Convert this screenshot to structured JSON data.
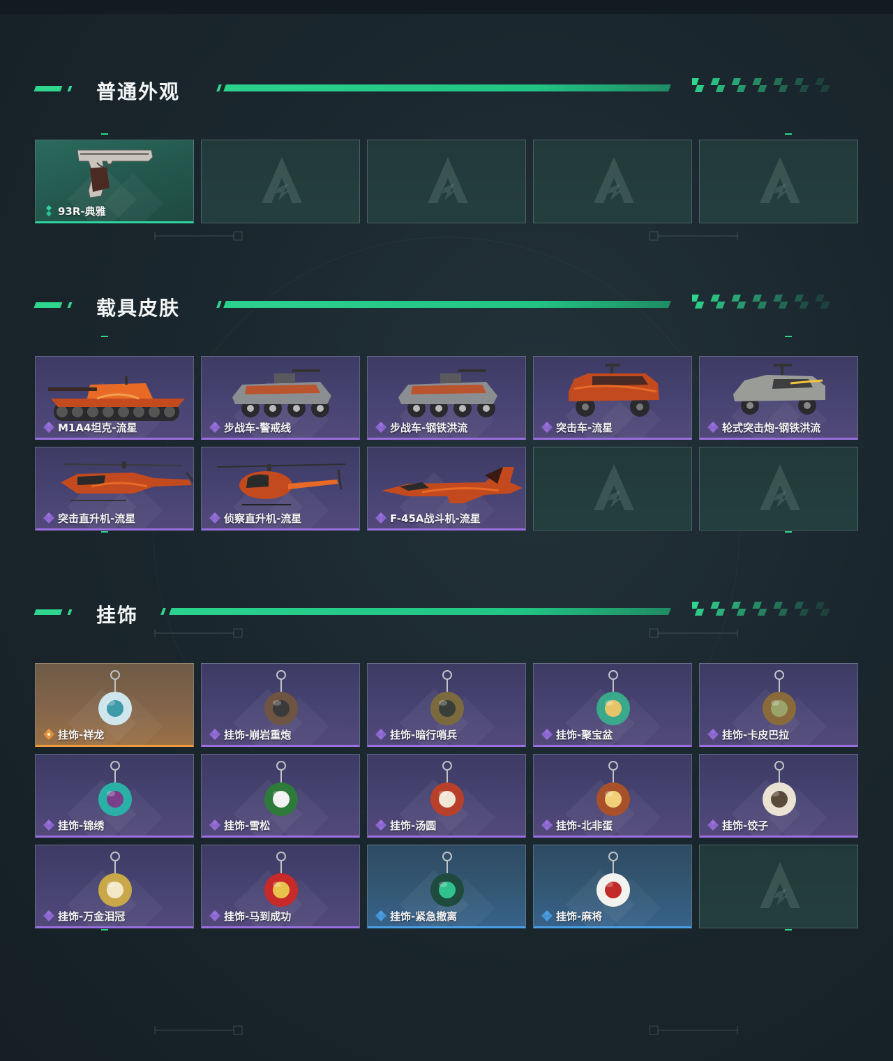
{
  "sections": {
    "appearance": {
      "title": "普通外观",
      "items": [
        {
          "label": "93R-典雅",
          "rarity": "green",
          "icon": "pistol-icon"
        }
      ]
    },
    "vehicle": {
      "title": "载具皮肤",
      "items": [
        {
          "label": "M1A4坦克-流星",
          "rarity": "purple",
          "icon": "tank-icon"
        },
        {
          "label": "步战车-警戒线",
          "rarity": "purple",
          "icon": "ifv-icon"
        },
        {
          "label": "步战车-钢铁洪流",
          "rarity": "purple",
          "icon": "ifv-icon"
        },
        {
          "label": "突击车-流星",
          "rarity": "purple",
          "icon": "assault-vehicle-icon"
        },
        {
          "label": "轮式突击炮-钢铁洪流",
          "rarity": "purple",
          "icon": "wheeled-assault-gun-icon"
        },
        {
          "label": "突击直升机-流星",
          "rarity": "purple",
          "icon": "attack-helicopter-icon"
        },
        {
          "label": "侦察直升机-流星",
          "rarity": "purple",
          "icon": "scout-helicopter-icon"
        },
        {
          "label": "F-45A战斗机-流星",
          "rarity": "purple",
          "icon": "fighter-jet-icon"
        }
      ]
    },
    "charm": {
      "title": "挂饰",
      "items": [
        {
          "label": "挂饰-祥龙",
          "rarity": "gold",
          "icon": "dragon-charm-icon"
        },
        {
          "label": "挂饰-崩岩重炮",
          "rarity": "purple",
          "icon": "soldier-charm-icon"
        },
        {
          "label": "挂饰-暗行哨兵",
          "rarity": "purple",
          "icon": "sentinel-charm-icon"
        },
        {
          "label": "挂饰-聚宝盆",
          "rarity": "purple",
          "icon": "treasure-bowl-charm-icon"
        },
        {
          "label": "挂饰-卡皮巴拉",
          "rarity": "purple",
          "icon": "capybara-charm-icon"
        },
        {
          "label": "挂饰-锦绣",
          "rarity": "purple",
          "icon": "butterfly-charm-icon"
        },
        {
          "label": "挂饰-雪松",
          "rarity": "purple",
          "icon": "pine-tree-charm-icon"
        },
        {
          "label": "挂饰-汤圆",
          "rarity": "purple",
          "icon": "tangyuan-charm-icon"
        },
        {
          "label": "挂饰-北非蛋",
          "rarity": "purple",
          "icon": "shakshuka-charm-icon"
        },
        {
          "label": "挂饰-饺子",
          "rarity": "purple",
          "icon": "dumpling-charm-icon"
        },
        {
          "label": "挂饰-万金泪冠",
          "rarity": "purple",
          "icon": "crown-charm-icon"
        },
        {
          "label": "挂饰-马到成功",
          "rarity": "purple",
          "icon": "horse-charm-icon"
        },
        {
          "label": "挂饰-紧急撤离",
          "rarity": "blue",
          "icon": "evacuation-charm-icon"
        },
        {
          "label": "挂饰-麻将",
          "rarity": "blue",
          "icon": "mahjong-charm-icon"
        }
      ]
    }
  },
  "colors": {
    "accent": "#2fd68e",
    "rarity_green": "#2fd3a0",
    "rarity_purple": "#9a6fe0",
    "rarity_gold": "#f09a3e",
    "rarity_blue": "#4aa0e6"
  }
}
